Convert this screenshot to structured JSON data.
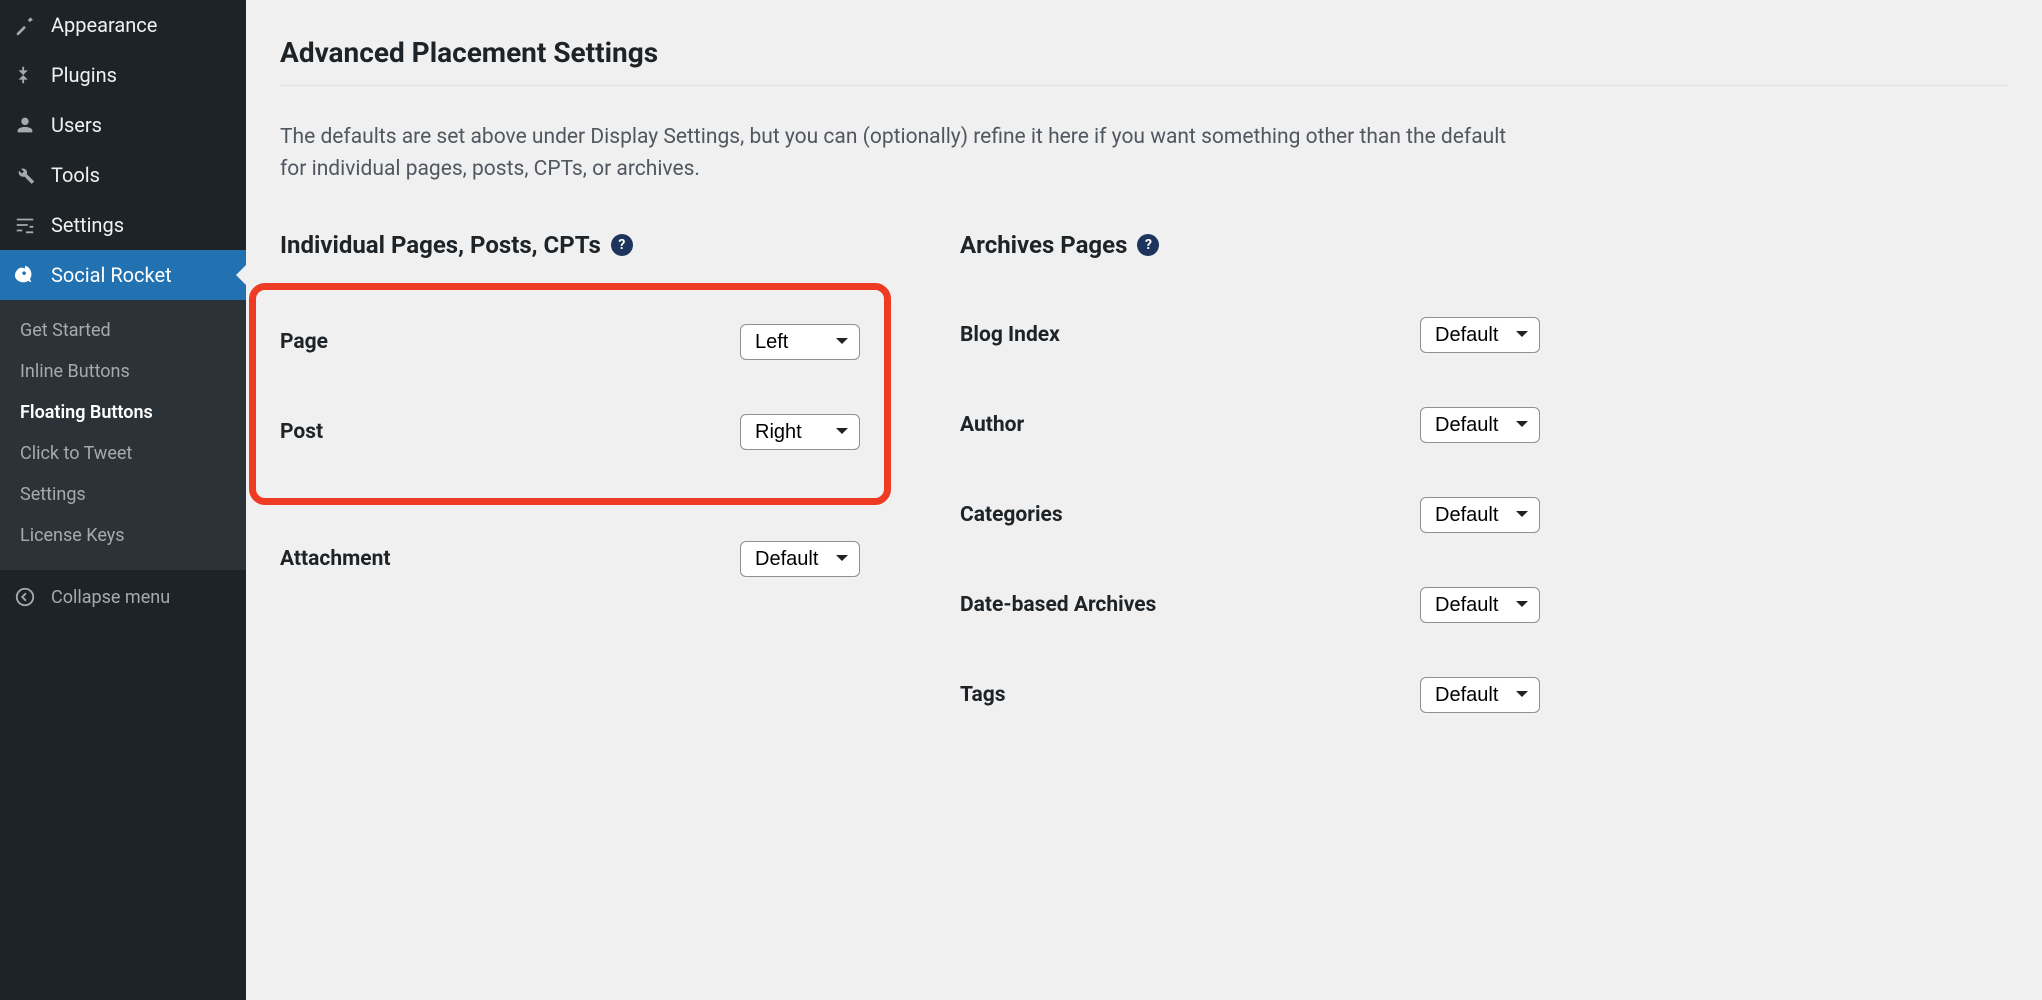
{
  "sidebar": {
    "items": [
      {
        "label": "Appearance",
        "icon": "appearance"
      },
      {
        "label": "Plugins",
        "icon": "plugins"
      },
      {
        "label": "Users",
        "icon": "users"
      },
      {
        "label": "Tools",
        "icon": "tools"
      },
      {
        "label": "Settings",
        "icon": "settings"
      },
      {
        "label": "Social Rocket",
        "icon": "rocket",
        "active": true
      }
    ],
    "submenu": [
      {
        "label": "Get Started"
      },
      {
        "label": "Inline Buttons"
      },
      {
        "label": "Floating Buttons",
        "current": true
      },
      {
        "label": "Click to Tweet"
      },
      {
        "label": "Settings"
      },
      {
        "label": "License Keys"
      }
    ],
    "collapse_label": "Collapse menu"
  },
  "page": {
    "title": "Advanced Placement Settings",
    "intro": "The defaults are set above under Display Settings, but you can (optionally) refine it here if you want something other than the default for individual pages, posts, CPTs, or archives."
  },
  "left_section": {
    "heading": "Individual Pages, Posts, CPTs",
    "rows": [
      {
        "label": "Page",
        "value": "Left"
      },
      {
        "label": "Post",
        "value": "Right"
      },
      {
        "label": "Attachment",
        "value": "Default"
      }
    ]
  },
  "right_section": {
    "heading": "Archives Pages",
    "rows": [
      {
        "label": "Blog Index",
        "value": "Default"
      },
      {
        "label": "Author",
        "value": "Default"
      },
      {
        "label": "Categories",
        "value": "Default"
      },
      {
        "label": "Date-based Archives",
        "value": "Default"
      },
      {
        "label": "Tags",
        "value": "Default"
      }
    ]
  },
  "select_options": [
    "Default",
    "Left",
    "Right"
  ]
}
